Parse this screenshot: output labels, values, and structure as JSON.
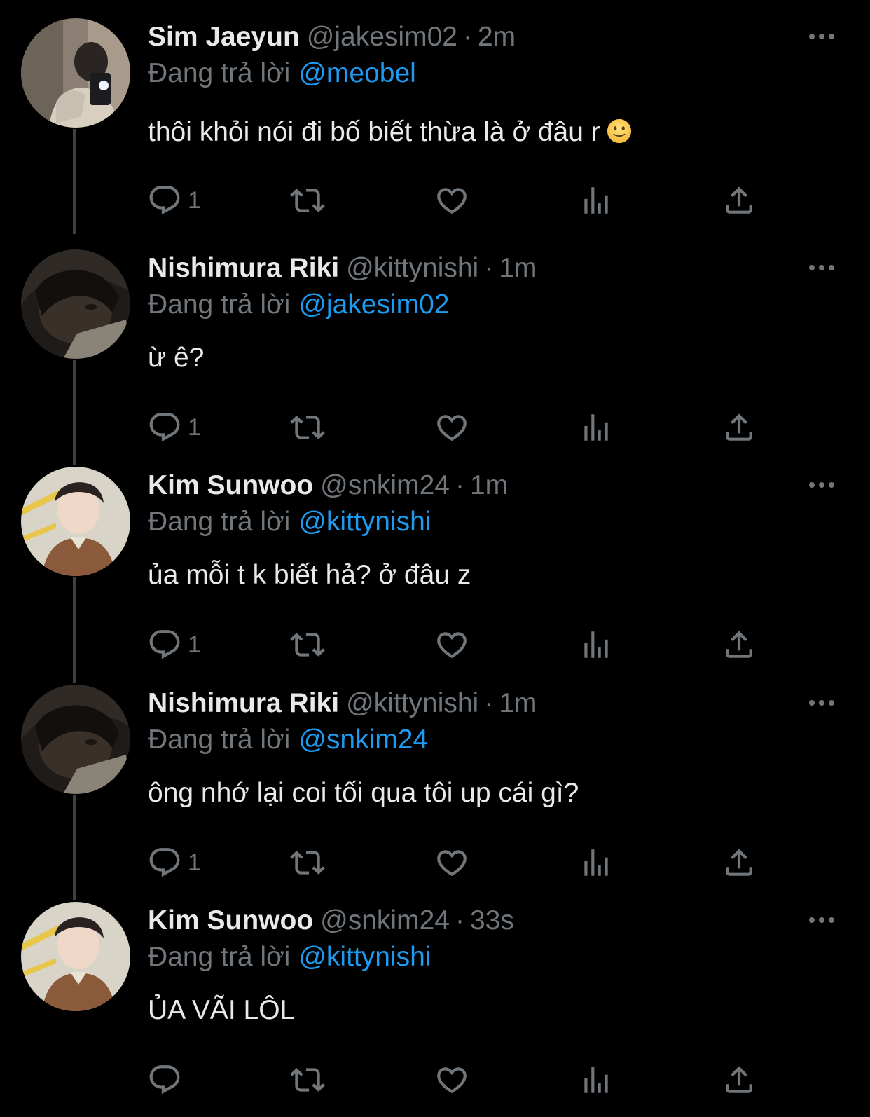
{
  "reply_prefix": "Đang trả lời",
  "colors": {
    "background": "#000000",
    "text": "#e7e9ea",
    "muted": "#71767b",
    "link": "#1d9bf0",
    "thread_line": "#3e4144"
  },
  "tweets": [
    {
      "display_name": "Sim Jaeyun",
      "handle": "@jakesim02",
      "time": "2m",
      "reply_to": "@meobel",
      "text": "thôi khỏi nói đi bố biết thừa là ở đâu r",
      "emoji": "slightly-smiling-face",
      "reply_count": "1"
    },
    {
      "display_name": "Nishimura Riki",
      "handle": "@kittynishi",
      "time": "1m",
      "reply_to": "@jakesim02",
      "text": "ừ ê?",
      "reply_count": "1"
    },
    {
      "display_name": "Kim Sunwoo",
      "handle": "@snkim24",
      "time": "1m",
      "reply_to": "@kittynishi",
      "text": "ủa mỗi t k biết hả? ở đâu z",
      "reply_count": "1"
    },
    {
      "display_name": "Nishimura Riki",
      "handle": "@kittynishi",
      "time": "1m",
      "reply_to": "@snkim24",
      "text": "ông nhớ lại coi tối qua tôi up cái gì?",
      "reply_count": "1"
    },
    {
      "display_name": "Kim Sunwoo",
      "handle": "@snkim24",
      "time": "33s",
      "reply_to": "@kittynishi",
      "text": "ỦA VÃI LÔL",
      "reply_count": ""
    }
  ],
  "icons": {
    "more": "more-horizontal-icon",
    "reply": "reply-bubble-icon",
    "retweet": "retweet-icon",
    "like": "heart-icon",
    "views": "views-bar-chart-icon",
    "share": "share-upload-icon"
  }
}
